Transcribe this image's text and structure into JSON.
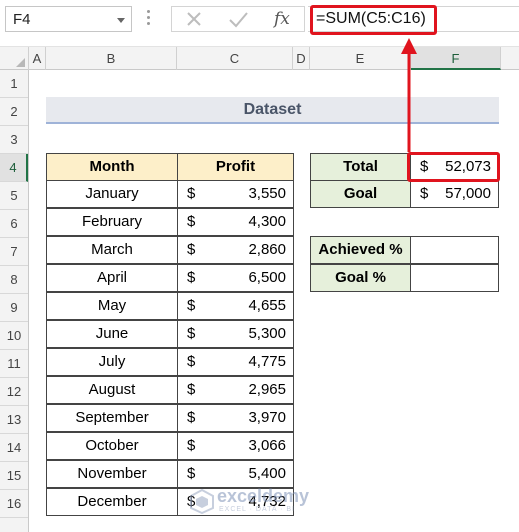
{
  "name_box": {
    "value": "F4"
  },
  "formula_bar": {
    "formula": "=SUM(C5:C16)",
    "fx_label": "fx"
  },
  "columns": [
    "A",
    "B",
    "C",
    "D",
    "E",
    "F"
  ],
  "rows": [
    "1",
    "2",
    "3",
    "4",
    "5",
    "6",
    "7",
    "8",
    "9",
    "10",
    "11",
    "12",
    "13",
    "14",
    "15",
    "16"
  ],
  "selected_column": "F",
  "selected_row": "4",
  "dataset_title": "Dataset",
  "table": {
    "headers": {
      "month": "Month",
      "profit": "Profit"
    },
    "currency": "$",
    "rows": [
      {
        "month": "January",
        "profit": "3,550"
      },
      {
        "month": "February",
        "profit": "4,300"
      },
      {
        "month": "March",
        "profit": "2,860"
      },
      {
        "month": "April",
        "profit": "6,500"
      },
      {
        "month": "May",
        "profit": "4,655"
      },
      {
        "month": "June",
        "profit": "5,300"
      },
      {
        "month": "July",
        "profit": "4,775"
      },
      {
        "month": "August",
        "profit": "2,965"
      },
      {
        "month": "September",
        "profit": "3,970"
      },
      {
        "month": "October",
        "profit": "3,066"
      },
      {
        "month": "November",
        "profit": "5,400"
      },
      {
        "month": "December",
        "profit": "4,732"
      }
    ]
  },
  "summary": {
    "total_label": "Total",
    "total_currency": "$",
    "total_value": "52,073",
    "goal_label": "Goal",
    "goal_currency": "$",
    "goal_value": "57,000"
  },
  "progress": {
    "achieved_label": "Achieved %",
    "goal_pct_label": "Goal %"
  },
  "watermark": {
    "name": "exceldemy",
    "tagline": "EXCEL · DATA · BI"
  },
  "colors": {
    "highlight_red": "#e0141e",
    "header_fill": "#fdefc9",
    "label_fill": "#e6f0db",
    "title_fill": "#e7e9ee",
    "excel_green": "#217346"
  }
}
